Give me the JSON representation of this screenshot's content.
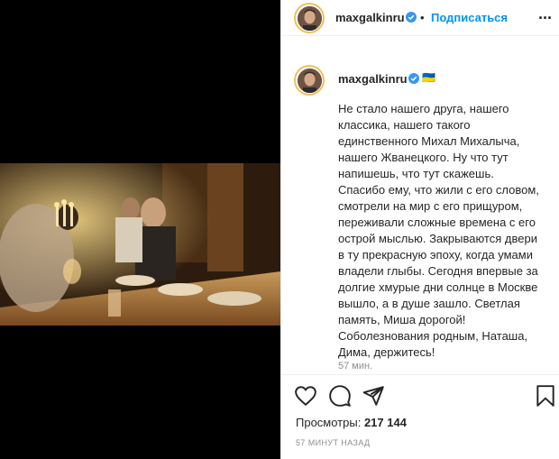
{
  "post": {
    "username": "maxgalkinru",
    "follow_label": "Подписаться",
    "dot": "•",
    "more_label": "···",
    "caption_emoji": "🇺🇦",
    "caption_lines": [
      "Не стало нашего друга, нашего",
      "классика, нашего такого",
      "единственного Михал Михалыча,",
      "нашего Жванецкого. Ну что тут",
      "напишешь, что тут скажешь.",
      "Спасибо ему, что жили с его словом,",
      "смотрели на мир с его прищуром,",
      "переживали сложные времена с его",
      "острой мыслью. Закрываются двери",
      "в ту прекрасную эпоху, когда умами",
      "владели глыбы. Сегодня впервые за",
      "долгие хмурые дни солнце в Москве",
      "вышло, а в душе зашло. Светлая",
      "память, Миша дорогой!",
      "Соболезнования родным, Наташа,",
      "Дима, держитесь!"
    ],
    "caption_time": "57 мин.",
    "views_label": "Просмотры:",
    "views_count": "217 144",
    "posted_ago": "57 МИНУТ НАЗАД"
  },
  "icons": {
    "like": "heart-icon",
    "comment": "comment-icon",
    "share": "share-icon",
    "save": "bookmark-icon",
    "verified": "verified-badge-icon",
    "more": "more-options-icon"
  },
  "colors": {
    "link_blue": "#0095f6",
    "verified_blue": "#3897f0",
    "muted_gray": "#8e8e8e",
    "story_ring": "#f0c05a"
  }
}
